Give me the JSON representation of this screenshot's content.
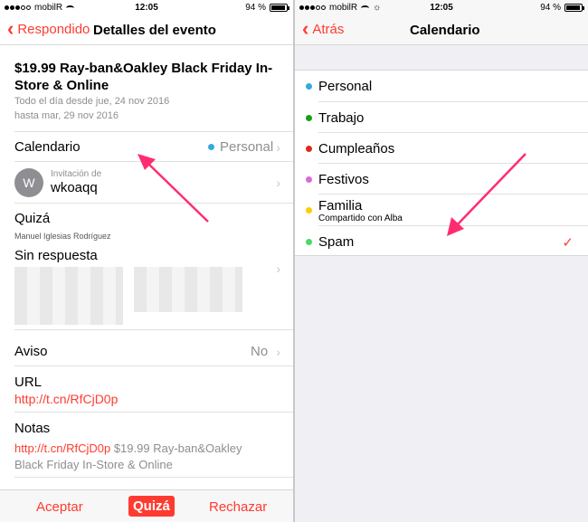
{
  "colors": {
    "accent": "#ff3b30",
    "arrow": "#ff2d6f"
  },
  "left": {
    "status": {
      "carrier": "mobilR",
      "time": "12:05",
      "battery": "94 %"
    },
    "nav": {
      "back": "Respondido",
      "title": "Detalles del evento"
    },
    "event": {
      "title": "$19.99 Ray-ban&Oakley Black Friday In-Store & Online",
      "date_line1": "Todo el día desde jue, 24 nov 2016",
      "date_line2": "hasta mar, 29 nov 2016"
    },
    "calendar": {
      "label": "Calendario",
      "value": "Personal",
      "dot_color": "#34aadc"
    },
    "invite": {
      "avatar_letter": "W",
      "caption": "Invitación de",
      "name": "wkoaqq"
    },
    "maybe": {
      "label": "Quizá",
      "person": "Manuel Iglesias Rodríguez"
    },
    "no_response": {
      "label": "Sin respuesta"
    },
    "alert": {
      "label": "Aviso",
      "value": "No"
    },
    "url": {
      "label": "URL",
      "value": "http://t.cn/RfCjD0p"
    },
    "notes": {
      "label": "Notas",
      "link": "http://t.cn/RfCjD0p",
      "text1": " $19.99 Ray-ban&Oakley",
      "text2": "Black Friday In-Store & Online"
    },
    "toolbar": {
      "accept": "Aceptar",
      "maybe": "Quizá",
      "decline": "Rechazar"
    }
  },
  "right": {
    "status": {
      "carrier": "mobilR",
      "time": "12:05",
      "battery": "94 %"
    },
    "nav": {
      "back": "Atrás",
      "title": "Calendario"
    },
    "calendars": [
      {
        "name": "Personal",
        "color": "#34aadc",
        "sub": ""
      },
      {
        "name": "Trabajo",
        "color": "#1a9e1a",
        "sub": ""
      },
      {
        "name": "Cumpleaños",
        "color": "#e0281c",
        "sub": ""
      },
      {
        "name": "Festivos",
        "color": "#d86bd8",
        "sub": ""
      },
      {
        "name": "Familia",
        "color": "#ffcc00",
        "sub": "Compartido con Alba"
      },
      {
        "name": "Spam",
        "color": "#4cd964",
        "sub": ""
      }
    ],
    "checkmark": "✓"
  }
}
